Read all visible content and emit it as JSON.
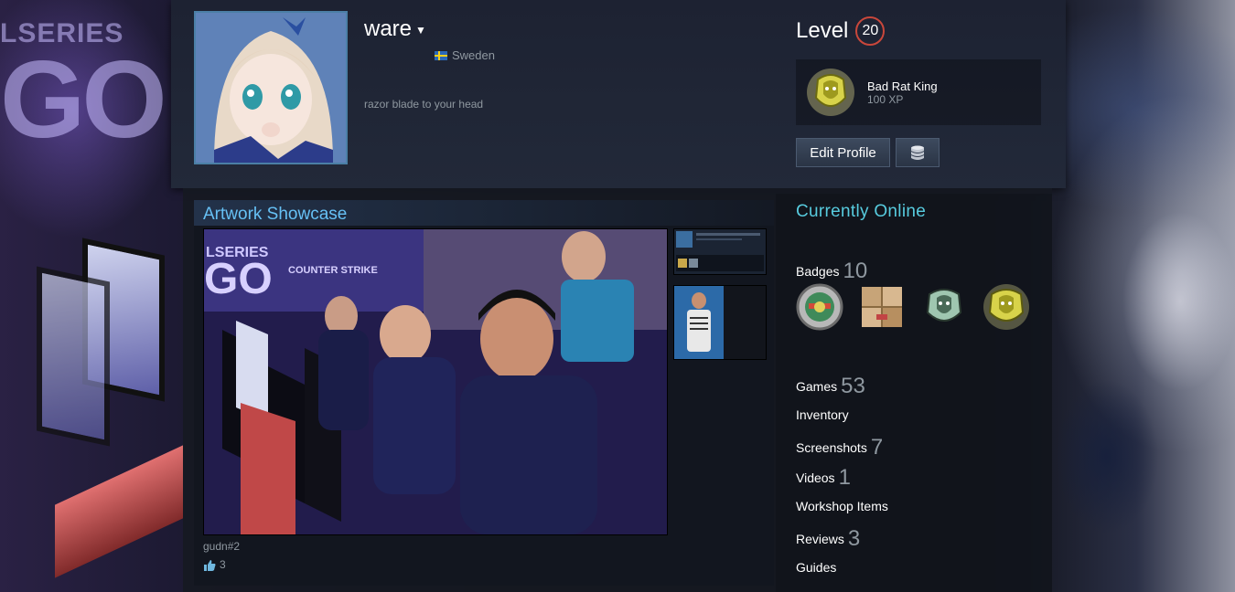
{
  "background": {
    "banner_line1": "LSERIES",
    "banner_line2": "GO",
    "art_banner_line1": "LSERIES",
    "art_banner_line2": "GO",
    "art_brand": "COUNTER STRIKE"
  },
  "profile": {
    "username": "ware",
    "country": "Sweden",
    "summary": "razor blade to your head"
  },
  "level": {
    "label": "Level",
    "value": "20"
  },
  "favorite_badge": {
    "name": "Bad Rat King",
    "xp": "100 XP"
  },
  "actions": {
    "edit_profile": "Edit Profile"
  },
  "showcase": {
    "title": "Artwork Showcase",
    "caption": "gudn#2",
    "likes": "3"
  },
  "right_column": {
    "status": "Currently Online",
    "badges_label": "Badges",
    "badges_count": "10",
    "badge_icons": [
      "coin-badge-icon",
      "room-badge-icon",
      "rat-king-silver-icon",
      "rat-king-gold-icon"
    ],
    "stats": [
      {
        "label": "Games",
        "count": "53"
      },
      {
        "label": "Inventory",
        "count": ""
      },
      {
        "label": "Screenshots",
        "count": "7"
      },
      {
        "label": "Videos",
        "count": "1"
      },
      {
        "label": "Workshop Items",
        "count": ""
      },
      {
        "label": "Reviews",
        "count": "3"
      },
      {
        "label": "Guides",
        "count": ""
      }
    ]
  },
  "colors": {
    "accent_blue": "#66c0f4",
    "online_cyan": "#57cbde",
    "level_ring": "#c9473b",
    "panel": "#222939"
  }
}
